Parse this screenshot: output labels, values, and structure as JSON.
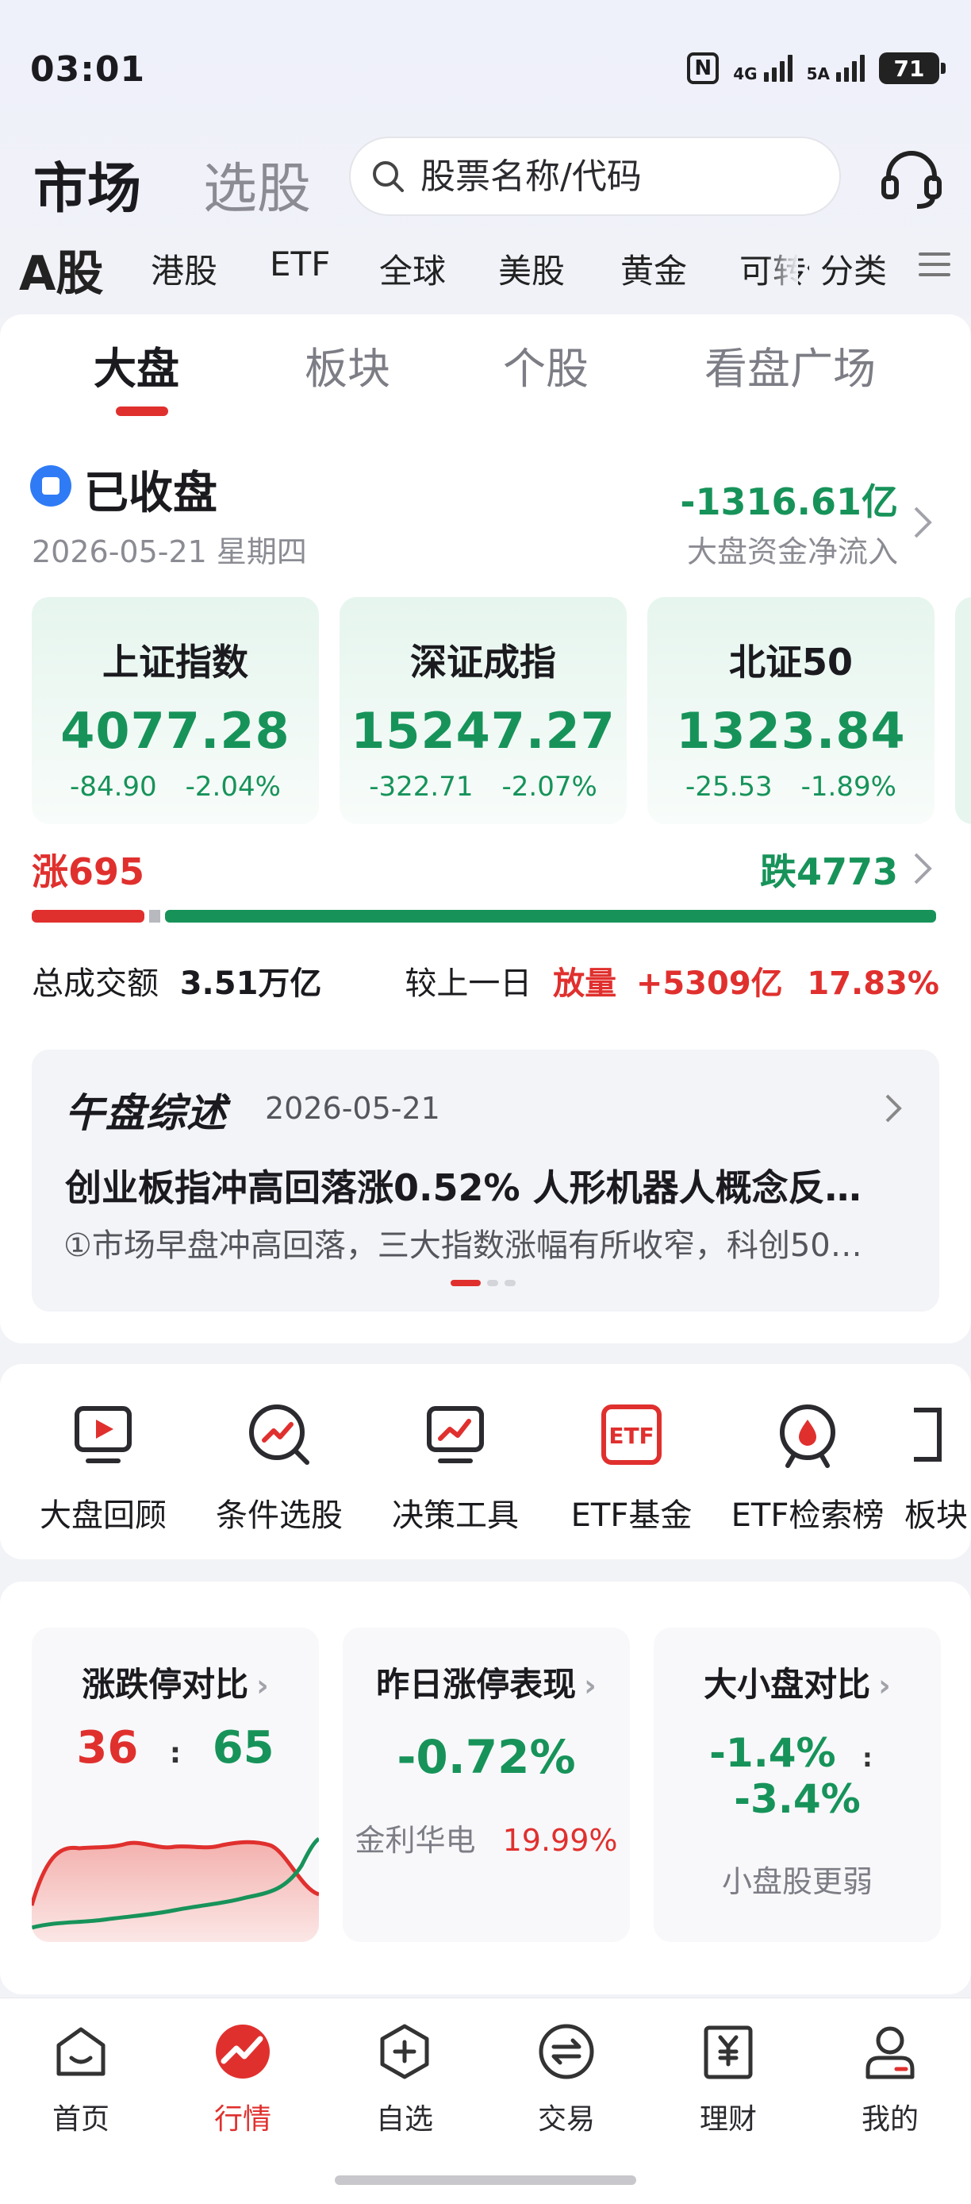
{
  "status_bar": {
    "time": "03:01",
    "nfc": "N",
    "sim1_label": "4G",
    "sim2_label": "5A",
    "battery": "71"
  },
  "header": {
    "tab_market": "市场",
    "tab_picker": "选股",
    "search_placeholder": "股票名称/代码"
  },
  "market_tabs": [
    {
      "label": "A股"
    },
    {
      "label": "港股"
    },
    {
      "label": "ETF"
    },
    {
      "label": "全球"
    },
    {
      "label": "美股"
    },
    {
      "label": "黄金"
    },
    {
      "label": "可转债"
    },
    {
      "label": "分类"
    }
  ],
  "sub_tabs": [
    {
      "label": "大盘"
    },
    {
      "label": "板块"
    },
    {
      "label": "个股"
    },
    {
      "label": "看盘广场"
    }
  ],
  "market_status": {
    "status": "已收盘",
    "date": "2026-05-21 星期四",
    "net_flow_value": "-1316.61亿",
    "net_flow_label": "大盘资金净流入"
  },
  "indices": [
    {
      "name": "上证指数",
      "price": "4077.28",
      "change": "-84.90",
      "change_pct": "-2.04%"
    },
    {
      "name": "深证成指",
      "price": "15247.27",
      "change": "-322.71",
      "change_pct": "-2.07%"
    },
    {
      "name": "北证50",
      "price": "1323.84",
      "change": "-25.53",
      "change_pct": "-1.89%"
    }
  ],
  "breadth": {
    "up_label": "涨695",
    "down_label": "跌4773",
    "up_count": 695,
    "down_count": 4773
  },
  "volume": {
    "label": "总成交额",
    "value": "3.51万亿",
    "compare_label": "较上一日",
    "compare_type": "放量",
    "compare_value": "+5309亿",
    "compare_pct": "17.83%"
  },
  "news": {
    "logo": "午盘综述",
    "date": "2026-05-21",
    "title": "创业板指冲高回落涨0.52% 人形机器人概念反…",
    "summary": "①市场早盘冲高回落，三大指数涨幅有所收窄，科创50…"
  },
  "tools": [
    {
      "label": "大盘回顾",
      "icon": "monitor-play-icon"
    },
    {
      "label": "条件选股",
      "icon": "search-trend-icon"
    },
    {
      "label": "决策工具",
      "icon": "chart-board-icon"
    },
    {
      "label": "ETF基金",
      "icon": "etf-icon"
    },
    {
      "label": "ETF检索榜",
      "icon": "drop-badge-icon"
    },
    {
      "label": "板块",
      "icon": "sector-icon"
    }
  ],
  "stats": {
    "limit": {
      "title": "涨跌停对比",
      "up": "36",
      "sep": ":",
      "down": "65"
    },
    "yesterday": {
      "title": "昨日涨停表现",
      "value": "-0.72%",
      "stock": "金利华电",
      "stock_pct": "19.99%"
    },
    "size": {
      "title": "大小盘对比",
      "big": "-1.4%",
      "sep": ":",
      "small": "-3.4%",
      "note": "小盘股更弱"
    }
  },
  "bottom_nav": [
    {
      "label": "首页",
      "icon": "home-icon"
    },
    {
      "label": "行情",
      "icon": "market-icon"
    },
    {
      "label": "自选",
      "icon": "add-watch-icon"
    },
    {
      "label": "交易",
      "icon": "trade-icon"
    },
    {
      "label": "理财",
      "icon": "wealth-icon"
    },
    {
      "label": "我的",
      "icon": "profile-icon"
    }
  ],
  "colors": {
    "up": "#e0302e",
    "down": "#17935a",
    "accent_blue": "#2f7bf6"
  }
}
